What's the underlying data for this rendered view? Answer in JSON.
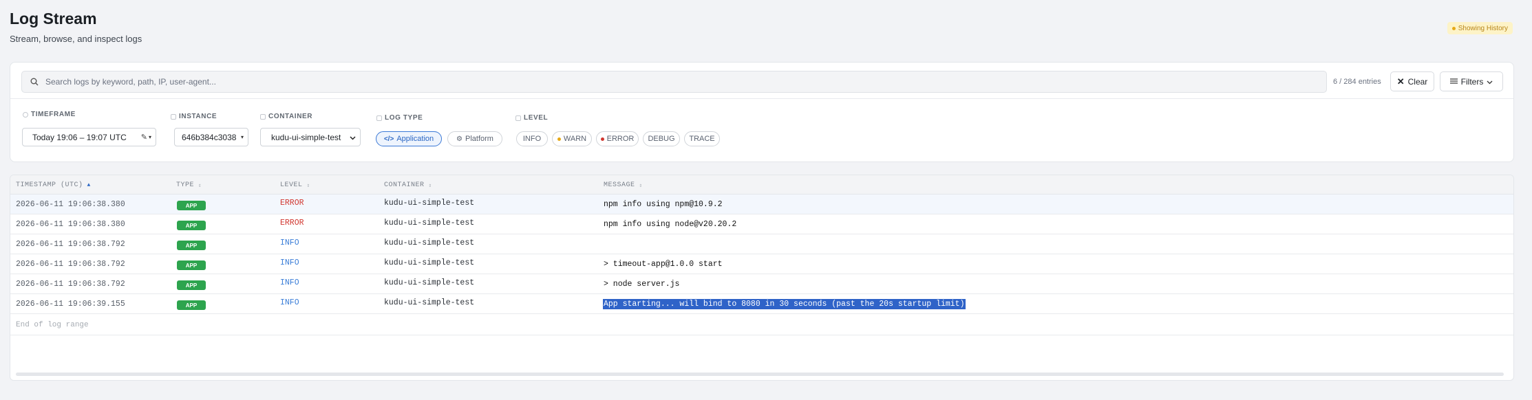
{
  "header": {
    "title": "Log Stream",
    "subtitle": "Stream, browse, and inspect logs",
    "history_badge": "Showing History"
  },
  "toolbar": {
    "search_placeholder": "Search logs by keyword, path, IP, user-agent...",
    "search_value": "",
    "entries_count": "6 / 284 entries",
    "clear_label": "Clear",
    "filters_label": "Filters"
  },
  "filters": {
    "timeframe": {
      "label": "TIMEFRAME",
      "value": "Today 19:06 – 19:07 UTC"
    },
    "instance": {
      "label": "INSTANCE",
      "value": "646b384c3038"
    },
    "container": {
      "label": "CONTAINER",
      "value": "kudu-ui-simple-test"
    },
    "log_type": {
      "label": "LOG TYPE",
      "options": [
        {
          "label": "Application",
          "icon": "code-icon",
          "active": true
        },
        {
          "label": "Platform",
          "icon": "gears-icon",
          "active": false
        }
      ]
    },
    "level": {
      "label": "LEVEL",
      "options": [
        {
          "label": "INFO",
          "dot": ""
        },
        {
          "label": "WARN",
          "dot": "#e6a817"
        },
        {
          "label": "ERROR",
          "dot": "#d1362f"
        },
        {
          "label": "DEBUG",
          "dot": ""
        },
        {
          "label": "TRACE",
          "dot": ""
        }
      ]
    }
  },
  "table": {
    "columns": {
      "timestamp": "TIMESTAMP (UTC)",
      "type": "TYPE",
      "level": "LEVEL",
      "container": "CONTAINER",
      "message": "MESSAGE"
    },
    "rows": [
      {
        "timestamp": "2026-06-11 19:06:38.380",
        "type": "APP",
        "level": "ERROR",
        "container": "kudu-ui-simple-test",
        "message": "npm info using npm@10.9.2"
      },
      {
        "timestamp": "2026-06-11 19:06:38.380",
        "type": "APP",
        "level": "ERROR",
        "container": "kudu-ui-simple-test",
        "message": "npm info using node@v20.20.2"
      },
      {
        "timestamp": "2026-06-11 19:06:38.792",
        "type": "APP",
        "level": "INFO",
        "container": "kudu-ui-simple-test",
        "message": ""
      },
      {
        "timestamp": "2026-06-11 19:06:38.792",
        "type": "APP",
        "level": "INFO",
        "container": "kudu-ui-simple-test",
        "message": "> timeout-app@1.0.0 start"
      },
      {
        "timestamp": "2026-06-11 19:06:38.792",
        "type": "APP",
        "level": "INFO",
        "container": "kudu-ui-simple-test",
        "message": "> node server.js"
      },
      {
        "timestamp": "2026-06-11 19:06:39.155",
        "type": "APP",
        "level": "INFO",
        "container": "kudu-ui-simple-test",
        "message": "App starting... will bind to 8080 in 30 seconds (past the 20s startup limit)"
      }
    ],
    "end_text": "End of log range"
  },
  "colors": {
    "accent": "#3a78d6",
    "app_badge": "#2da44e",
    "error": "#d1362f",
    "info": "#3b7ed8",
    "selection": "#2f63c8"
  }
}
